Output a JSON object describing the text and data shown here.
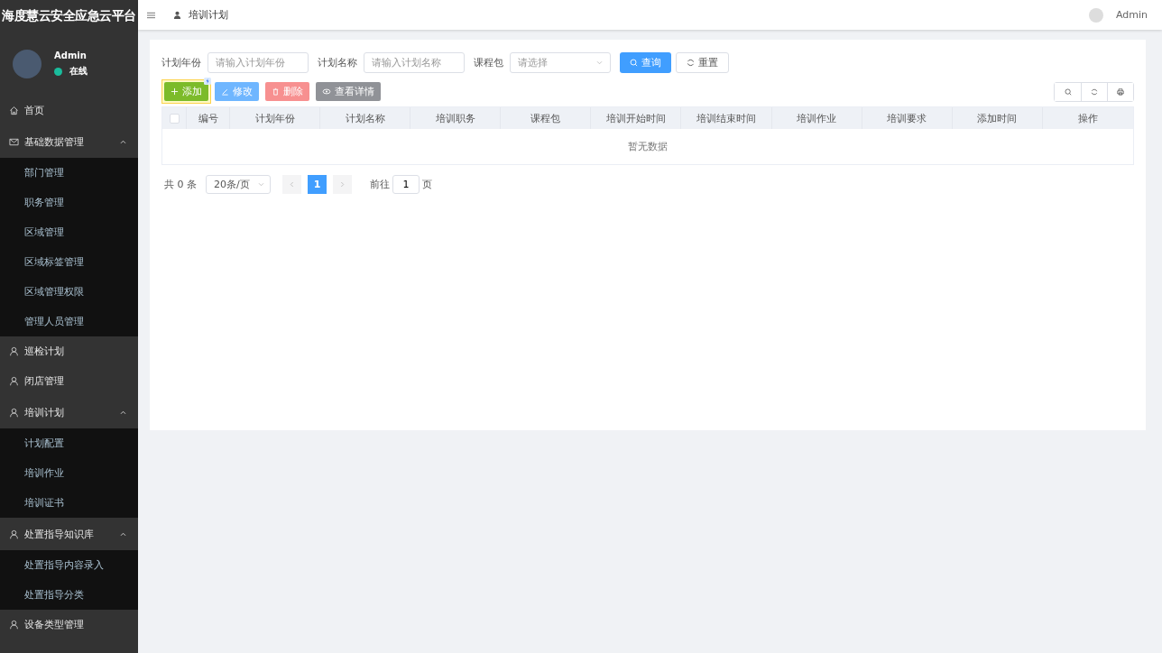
{
  "sidebar": {
    "brand": "海度慧云安全应急云平台",
    "user": {
      "name": "Admin",
      "status": "在线"
    },
    "menu": [
      {
        "label": "首页",
        "kind": "item"
      },
      {
        "label": "基础数据管理",
        "kind": "group",
        "expanded": true,
        "children": [
          {
            "label": "部门管理"
          },
          {
            "label": "职务管理"
          },
          {
            "label": "区域管理"
          },
          {
            "label": "区域标签管理"
          },
          {
            "label": "区域管理权限"
          },
          {
            "label": "管理人员管理"
          }
        ]
      },
      {
        "label": "巡检计划",
        "kind": "item"
      },
      {
        "label": "闭店管理",
        "kind": "item"
      },
      {
        "label": "培训计划",
        "kind": "group",
        "expanded": true,
        "children": [
          {
            "label": "计划配置"
          },
          {
            "label": "培训作业"
          },
          {
            "label": "培训证书"
          }
        ]
      },
      {
        "label": "处置指导知识库",
        "kind": "group",
        "expanded": true,
        "children": [
          {
            "label": "处置指导内容录入"
          },
          {
            "label": "处置指导分类"
          }
        ]
      },
      {
        "label": "设备类型管理",
        "kind": "item"
      }
    ]
  },
  "header": {
    "breadcrumb": "培训计划",
    "user": "Admin"
  },
  "filters": [
    {
      "label": "计划年份",
      "kind": "input",
      "placeholder": "请输入计划年份"
    },
    {
      "label": "计划名称",
      "kind": "input",
      "placeholder": "请输入计划名称"
    },
    {
      "label": "课程包",
      "kind": "select",
      "placeholder": "请选择"
    }
  ],
  "search_button": "查询",
  "reset_button": "重置",
  "actions": [
    {
      "label": "添加",
      "kind": "add",
      "disabled": false,
      "highlighted": true
    },
    {
      "label": "修改",
      "kind": "edit",
      "disabled": true,
      "highlighted": false
    },
    {
      "label": "删除",
      "kind": "delete",
      "disabled": true,
      "highlighted": false
    },
    {
      "label": "查看详情",
      "kind": "view",
      "disabled": true,
      "highlighted": false
    }
  ],
  "table": {
    "columns": [
      "编号",
      "计划年份",
      "计划名称",
      "培训职务",
      "课程包",
      "培训开始时间",
      "培训结束时间",
      "培训作业",
      "培训要求",
      "添加时间",
      "操作"
    ],
    "select_all_checked": false,
    "empty_text": "暂无数据"
  },
  "pagination": {
    "total": "共 0 条",
    "page_size": "20条/页",
    "pages": [
      {
        "label": "1",
        "selected": true
      }
    ],
    "goto_label": "前往",
    "goto_value": "1",
    "goto_suffix": "页"
  }
}
